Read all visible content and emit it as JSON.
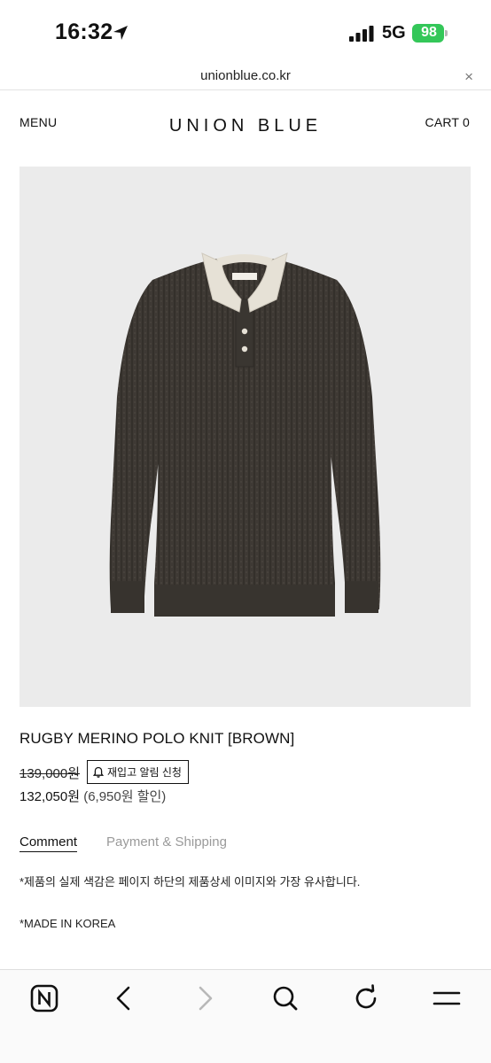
{
  "status_bar": {
    "time": "16:32",
    "network": "5G",
    "battery": "98"
  },
  "browser": {
    "url": "unionblue.co.kr",
    "close_icon": "×"
  },
  "header": {
    "menu_label": "MENU",
    "logo": "UNION BLUE",
    "cart_label": "CART 0"
  },
  "product": {
    "image_icon": "knit-polo-sweater-image",
    "title": "RUGBY MERINO POLO KNIT [BROWN]",
    "original_price": "139,000원",
    "restock_button": "재입고 알림 신청",
    "sale_price": "132,050원",
    "discount_text": "(6,950원 할인)",
    "colors": {
      "sweater": "#3d3833",
      "collar": "#e6e1d6",
      "background": "#ebebeb"
    }
  },
  "tabs": [
    {
      "label": "Comment",
      "active": true
    },
    {
      "label": "Payment & Shipping",
      "active": false
    }
  ],
  "content": {
    "notice": "*제품의 실제 색감은 페이지 하단의 제품상세 이미지와 가장 유사합니다.",
    "origin": "*MADE IN KOREA"
  },
  "toolbar": {
    "icons": [
      "naver-home-icon",
      "back-icon",
      "forward-icon",
      "search-icon",
      "reload-icon",
      "menu-icon"
    ]
  }
}
